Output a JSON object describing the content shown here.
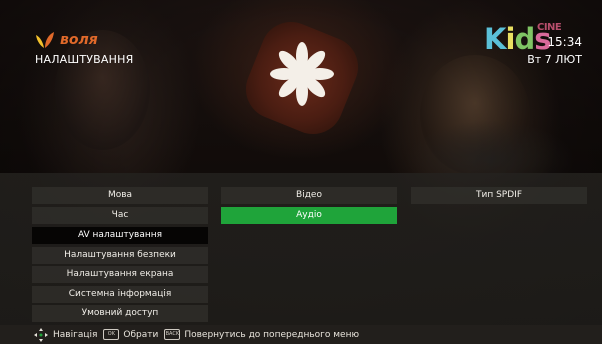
{
  "brand": {
    "name": "воля",
    "logo_icon": "volia-leaf-logo"
  },
  "header": {
    "title": "НАЛАШТУВАННЯ"
  },
  "channel": {
    "logo_letters": [
      "K",
      "i",
      "d",
      "s"
    ],
    "cinema_text": "CINE"
  },
  "clock": {
    "time": "15:34",
    "date": "Вт 7 ЛЮТ"
  },
  "menu": {
    "items": [
      {
        "label": "Мова"
      },
      {
        "label": "Час"
      },
      {
        "label": "AV налаштування",
        "active": true
      },
      {
        "label": "Налаштування безпеки"
      },
      {
        "label": "Налаштування екрана"
      },
      {
        "label": "Системна інформація"
      },
      {
        "label": "Умовний доступ"
      }
    ]
  },
  "options": {
    "items": [
      {
        "label": "Відео"
      },
      {
        "label": "Аудіо",
        "selected": true
      }
    ]
  },
  "submenu": {
    "items": [
      {
        "label": "Тип SPDIF"
      }
    ]
  },
  "footer": {
    "navigate_label": "Навігація",
    "ok_key": "OK",
    "ok_label": "Обрати",
    "back_key": "BACK",
    "back_label": "Повернутись до попереднього меню"
  },
  "colors": {
    "accent_green": "#1fa43a",
    "brand_orange": "#e0692a"
  }
}
